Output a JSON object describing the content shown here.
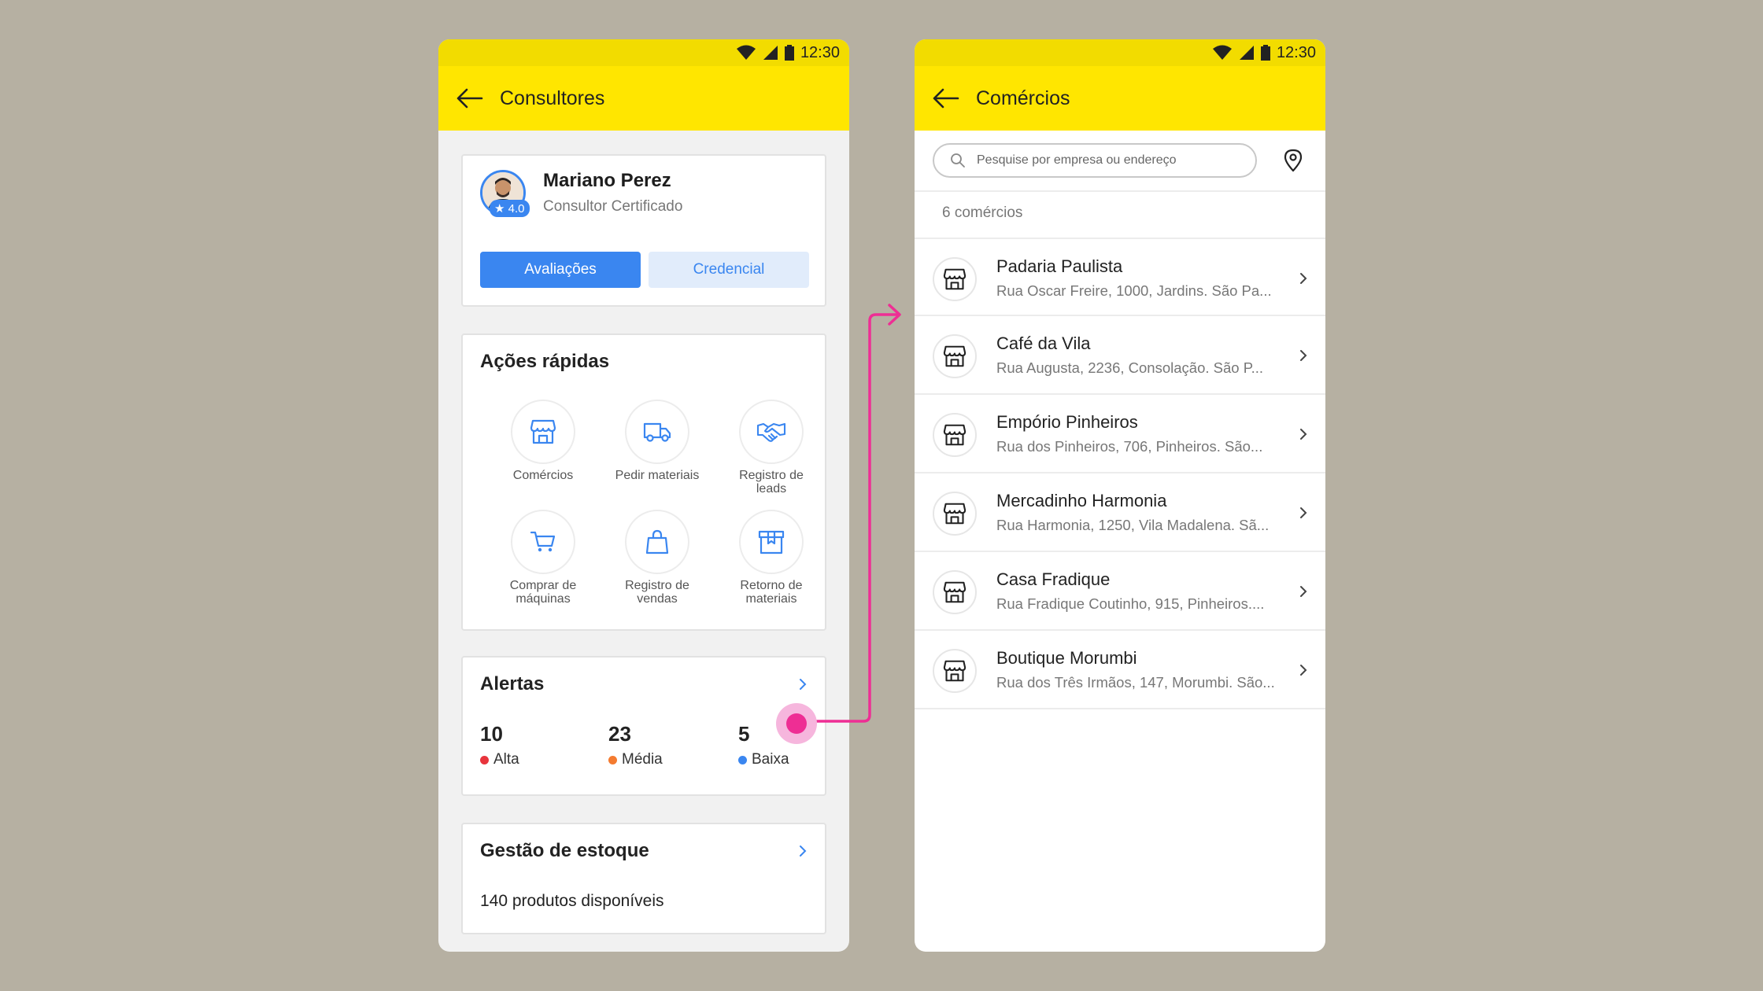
{
  "statusbar": {
    "time": "12:30"
  },
  "left_screen": {
    "title": "Consultores",
    "profile": {
      "name": "Mariano Perez",
      "role": "Consultor Certificado",
      "rating": "4.0",
      "rating_icon": "star-icon",
      "primary_button": "Avaliações",
      "secondary_button": "Credencial"
    },
    "quick_actions": {
      "title": "Ações rápidas",
      "items": [
        {
          "label": "Comércios",
          "icon": "store-icon"
        },
        {
          "label": "Pedir materiais",
          "icon": "truck-icon"
        },
        {
          "label": "Registro de leads",
          "icon": "handshake-icon"
        },
        {
          "label": "Comprar de máquinas",
          "icon": "cart-icon"
        },
        {
          "label": "Registro de vendas",
          "icon": "shopping-bag-icon"
        },
        {
          "label": "Retorno de materiais",
          "icon": "box-return-icon"
        }
      ]
    },
    "alerts": {
      "title": "Alertas",
      "items": [
        {
          "value": "10",
          "label": "Alta",
          "color": "#e8343c"
        },
        {
          "value": "23",
          "label": "Média",
          "color": "#f47b30"
        },
        {
          "value": "5",
          "label": "Baixa",
          "color": "#3a86f0"
        }
      ]
    },
    "stock": {
      "title": "Gestão de estoque",
      "text": "140 produtos disponíveis"
    }
  },
  "right_screen": {
    "title": "Comércios",
    "search_placeholder": "Pesquise por empresa ou endereço",
    "count": "6 comércios",
    "shops": [
      {
        "name": "Padaria Paulista",
        "address": "Rua Oscar Freire, 1000, Jardins. São Pa..."
      },
      {
        "name": "Café da Vila",
        "address": "Rua Augusta, 2236, Consolação. São P..."
      },
      {
        "name": "Empório Pinheiros",
        "address": "Rua dos Pinheiros, 706, Pinheiros. São..."
      },
      {
        "name": "Mercadinho Harmonia",
        "address": "Rua Harmonia, 1250, Vila Madalena. Sã..."
      },
      {
        "name": "Casa Fradique",
        "address": "Rua Fradique Coutinho, 915, Pinheiros...."
      },
      {
        "name": "Boutique Morumbi",
        "address": "Rua dos Três Irmãos, 147, Morumbi. São..."
      }
    ]
  },
  "colors": {
    "brand_yellow": "#ffe600",
    "primary_blue": "#3a86f0",
    "flow_pink": "#ee2e94"
  }
}
